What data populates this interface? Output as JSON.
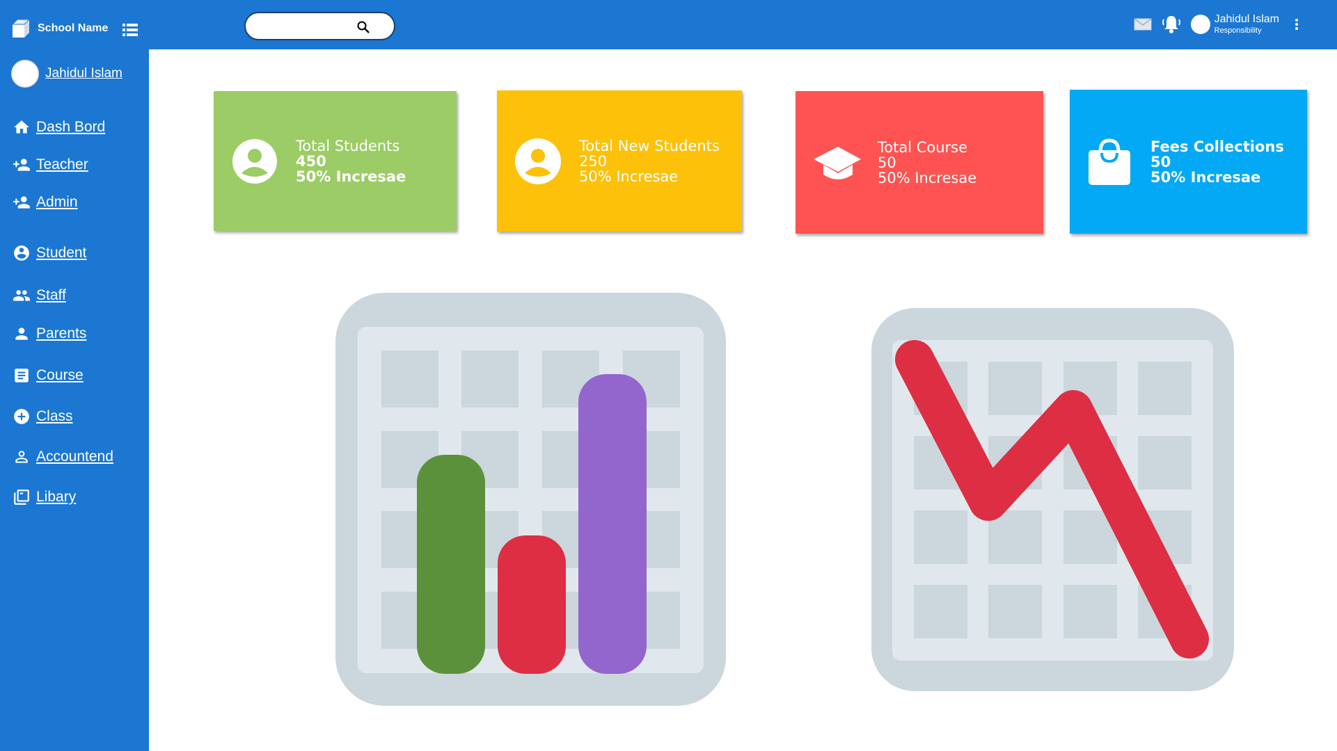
{
  "header": {
    "school_name": "School Name",
    "search_placeholder": "",
    "user_name": "Jahidul Islam",
    "user_role": "Responsibility"
  },
  "sidebar": {
    "user_name": "Jahidul Islam",
    "items": [
      {
        "label": "Dash Bord",
        "icon": "home-icon"
      },
      {
        "label": "Teacher",
        "icon": "person-add-icon"
      },
      {
        "label": "Admin",
        "icon": "person-add-icon"
      },
      {
        "label": "Student",
        "icon": "account-circle-icon"
      },
      {
        "label": "Staff",
        "icon": "people-icon"
      },
      {
        "label": "Parents",
        "icon": "person-icon"
      },
      {
        "label": "Course",
        "icon": "document-icon"
      },
      {
        "label": "Class",
        "icon": "add-circle-icon"
      },
      {
        "label": "Accountend",
        "icon": "person-outline-icon"
      },
      {
        "label": "Libary",
        "icon": "library-icon"
      }
    ]
  },
  "cards": [
    {
      "title": "Total Students",
      "value": "450",
      "change": "50% Incresae",
      "color": "#9ccc65",
      "icon": "account-circle-icon"
    },
    {
      "title": "Total New Students",
      "value": "250",
      "change": "50% Incresae",
      "color": "#fdc109",
      "icon": "account-circle-icon"
    },
    {
      "title": "Total Course",
      "value": "50",
      "change": "50% Incresae",
      "color": "#fe5352",
      "icon": "graduation-cap-icon"
    },
    {
      "title": "Fees Collections",
      "value": "50",
      "change": "50% Incresae",
      "color": "#03a9f4",
      "icon": "shopping-bag-icon"
    }
  ],
  "colors": {
    "primary": "#1b77d2",
    "bar_green": "#5c913b",
    "bar_red": "#dd2e44",
    "bar_purple": "#9266cc",
    "frame_gray": "#ccd6dd",
    "inner_gray": "#e1e8ed"
  }
}
